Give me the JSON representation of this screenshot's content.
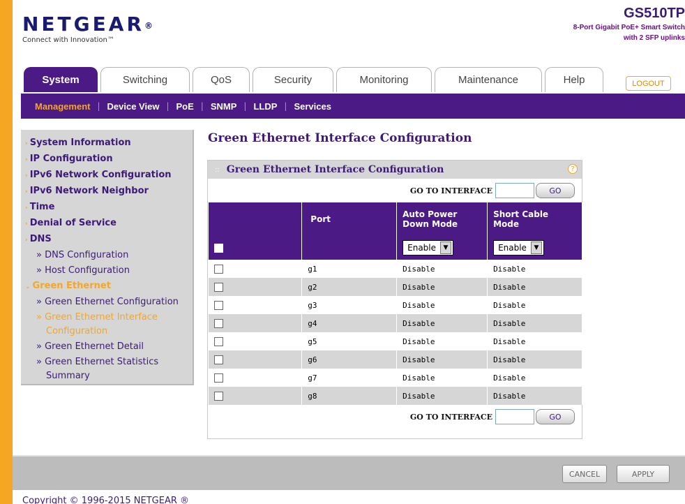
{
  "header": {
    "brand": "NETGEAR",
    "brand_mark": "®",
    "tagline": "Connect with Innovation™",
    "model": "GS510TP",
    "model_desc_line1": "8-Port Gigabit PoE+ Smart Switch",
    "model_desc_line2": "with 2 SFP uplinks"
  },
  "tabs": [
    {
      "label": "System",
      "active": true
    },
    {
      "label": "Switching"
    },
    {
      "label": "QoS"
    },
    {
      "label": "Security"
    },
    {
      "label": "Monitoring"
    },
    {
      "label": "Maintenance"
    },
    {
      "label": "Help"
    }
  ],
  "logout_label": "LOGOUT",
  "subnav": [
    {
      "label": "Management",
      "active": true
    },
    {
      "label": "Device View"
    },
    {
      "label": "PoE"
    },
    {
      "label": "SNMP"
    },
    {
      "label": "LLDP"
    },
    {
      "label": "Services"
    }
  ],
  "sidebar": {
    "items": [
      "System Information",
      "IP Configuration",
      "IPv6 Network Configuration",
      "IPv6 Network Neighbor",
      "Time",
      "Denial of Service",
      "DNS",
      "» DNS Configuration",
      "» Host Configuration",
      "Green Ethernet",
      "» Green Ethernet Configuration",
      "» Green Ethernet Interface",
      "Configuration",
      "» Green Ethernet Detail",
      "» Green Ethernet Statistics",
      "Summary"
    ]
  },
  "page_title": "Green Ethernet Interface Configuration",
  "panel": {
    "title": "Green Ethernet Interface Configuration",
    "help": "?",
    "goto_label": "GO TO INTERFACE",
    "go_label": "GO",
    "columns": [
      "",
      "Port",
      "Auto Power Down Mode",
      "Short Cable Mode"
    ],
    "bulk_auto_power": "Enable",
    "bulk_short_cable": "Enable",
    "rows": [
      {
        "port": "g1",
        "auto_power": "Disable",
        "short_cable": "Disable"
      },
      {
        "port": "g2",
        "auto_power": "Disable",
        "short_cable": "Disable"
      },
      {
        "port": "g3",
        "auto_power": "Disable",
        "short_cable": "Disable"
      },
      {
        "port": "g4",
        "auto_power": "Disable",
        "short_cable": "Disable"
      },
      {
        "port": "g5",
        "auto_power": "Disable",
        "short_cable": "Disable"
      },
      {
        "port": "g6",
        "auto_power": "Disable",
        "short_cable": "Disable"
      },
      {
        "port": "g7",
        "auto_power": "Disable",
        "short_cable": "Disable"
      },
      {
        "port": "g8",
        "auto_power": "Disable",
        "short_cable": "Disable"
      }
    ]
  },
  "footer": {
    "cancel_label": "CANCEL",
    "apply_label": "APPLY",
    "copyright": "Copyright © 1996-2015 NETGEAR ®"
  },
  "colors": {
    "brand_purple": "#4b1a84",
    "accent_orange": "#f5a623",
    "panel_gray": "#d6d6d6"
  }
}
